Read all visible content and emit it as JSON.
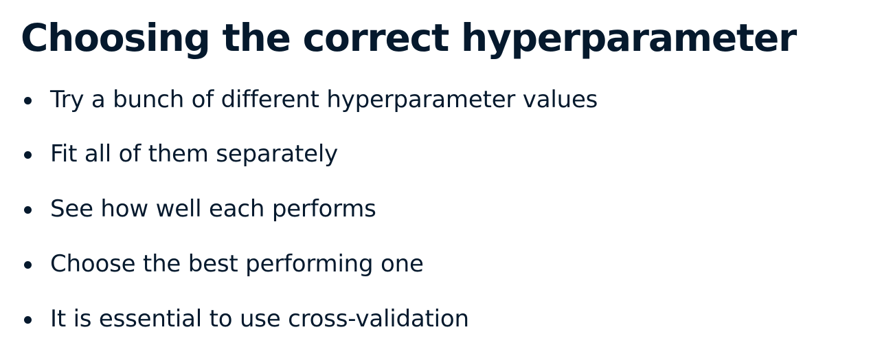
{
  "slide": {
    "title": "Choosing the correct hyperparameter",
    "bullets": [
      "Try a bunch of different hyperparameter values",
      "Fit all of them separately",
      "See how well each performs",
      "Choose the best performing one",
      "It is essential to use cross-validation"
    ]
  },
  "colors": {
    "text": "#05192d",
    "background": "#ffffff"
  }
}
